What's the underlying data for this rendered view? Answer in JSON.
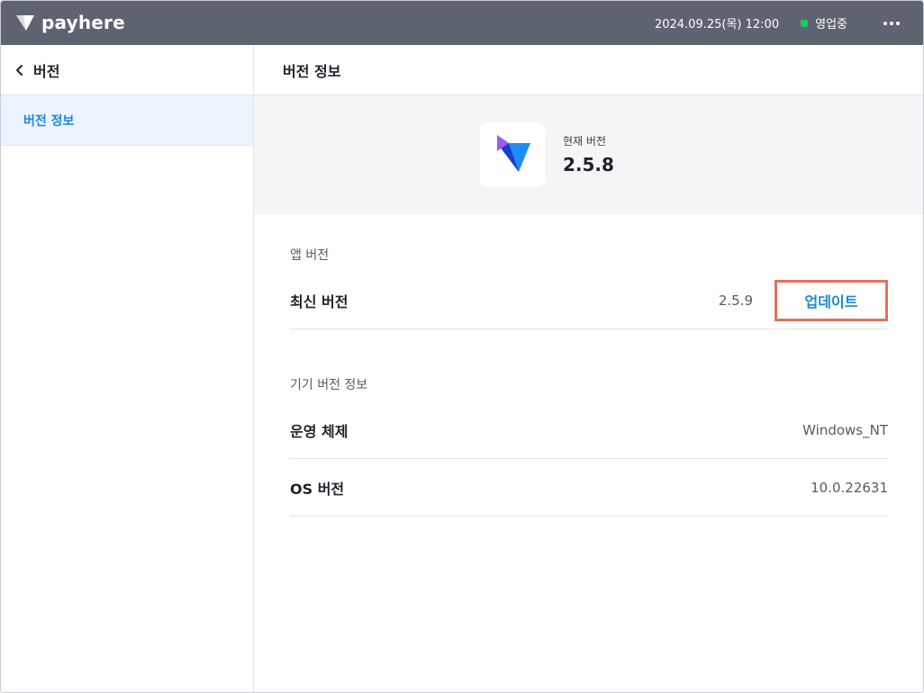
{
  "brand": {
    "name": "payhere",
    "logo_icon": "payhere-logo-icon"
  },
  "topbar": {
    "datetime": "2024.09.25(목) 12:00",
    "status_label": "영업중",
    "status_color": "#22c55e",
    "more_icon": "more-horizontal-icon"
  },
  "sidebar": {
    "back_icon": "chevron-left-icon",
    "title": "버전",
    "items": [
      {
        "label": "버전 정보",
        "selected": true
      }
    ]
  },
  "main": {
    "title": "버전 정보",
    "hero": {
      "icon": "app-logo-icon",
      "current_label": "현재 버전",
      "current_value": "2.5.8"
    },
    "app_section": {
      "label": "앱 버전",
      "rows": [
        {
          "label": "최신 버전",
          "value": "2.5.9",
          "action": "업데이트"
        }
      ]
    },
    "device_section": {
      "label": "기기 버전 정보",
      "rows": [
        {
          "label": "운영 체제",
          "value": "Windows_NT"
        },
        {
          "label": "OS 버전",
          "value": "10.0.22631"
        }
      ]
    }
  },
  "colors": {
    "topbar": "#5d6470",
    "accent": "#1e87d6",
    "highlight": "#e4705e",
    "selected_bg": "#ebf4fc"
  }
}
